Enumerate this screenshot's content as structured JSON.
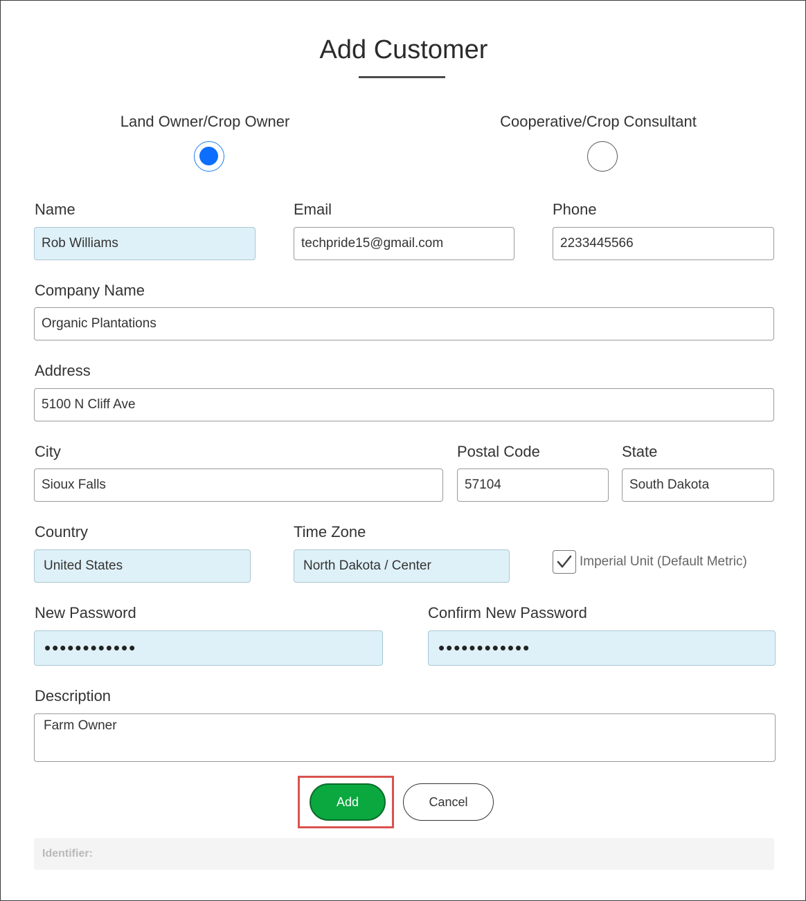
{
  "page": {
    "title": "Add Customer"
  },
  "account_type": {
    "options": [
      {
        "label": "Land Owner/Crop Owner",
        "selected": true
      },
      {
        "label": "Cooperative/Crop Consultant",
        "selected": false
      }
    ]
  },
  "form": {
    "name": {
      "label": "Name",
      "value": "Rob Williams"
    },
    "email": {
      "label": "Email",
      "value": "techpride15@gmail.com"
    },
    "phone": {
      "label": "Phone",
      "value": "2233445566"
    },
    "company_name": {
      "label": "Company Name",
      "value": "Organic Plantations"
    },
    "address": {
      "label": "Address",
      "value": "5100 N Cliff Ave"
    },
    "city": {
      "label": "City",
      "value": "Sioux Falls"
    },
    "postal_code": {
      "label": "Postal Code",
      "value": "57104"
    },
    "state": {
      "label": "State",
      "value": "South Dakota"
    },
    "country": {
      "label": "Country",
      "value": "United States"
    },
    "time_zone": {
      "label": "Time Zone",
      "value": "North Dakota / Center"
    },
    "imperial_unit": {
      "label": "Imperial Unit (Default Metric)",
      "checked": true
    },
    "new_password": {
      "label": "New Password",
      "value": "••••••••••••"
    },
    "confirm_password": {
      "label": "Confirm New Password",
      "value": "••••••••••••"
    },
    "description": {
      "label": "Description",
      "value": "Farm Owner"
    }
  },
  "buttons": {
    "add_label": "Add",
    "cancel_label": "Cancel"
  },
  "footer": {
    "identifier_label": "Identifier:"
  },
  "colors": {
    "accent": "#0d6efd",
    "add_button": "#0aa83f",
    "highlight": "#d9534f",
    "filled_field": "#dff1f8"
  }
}
